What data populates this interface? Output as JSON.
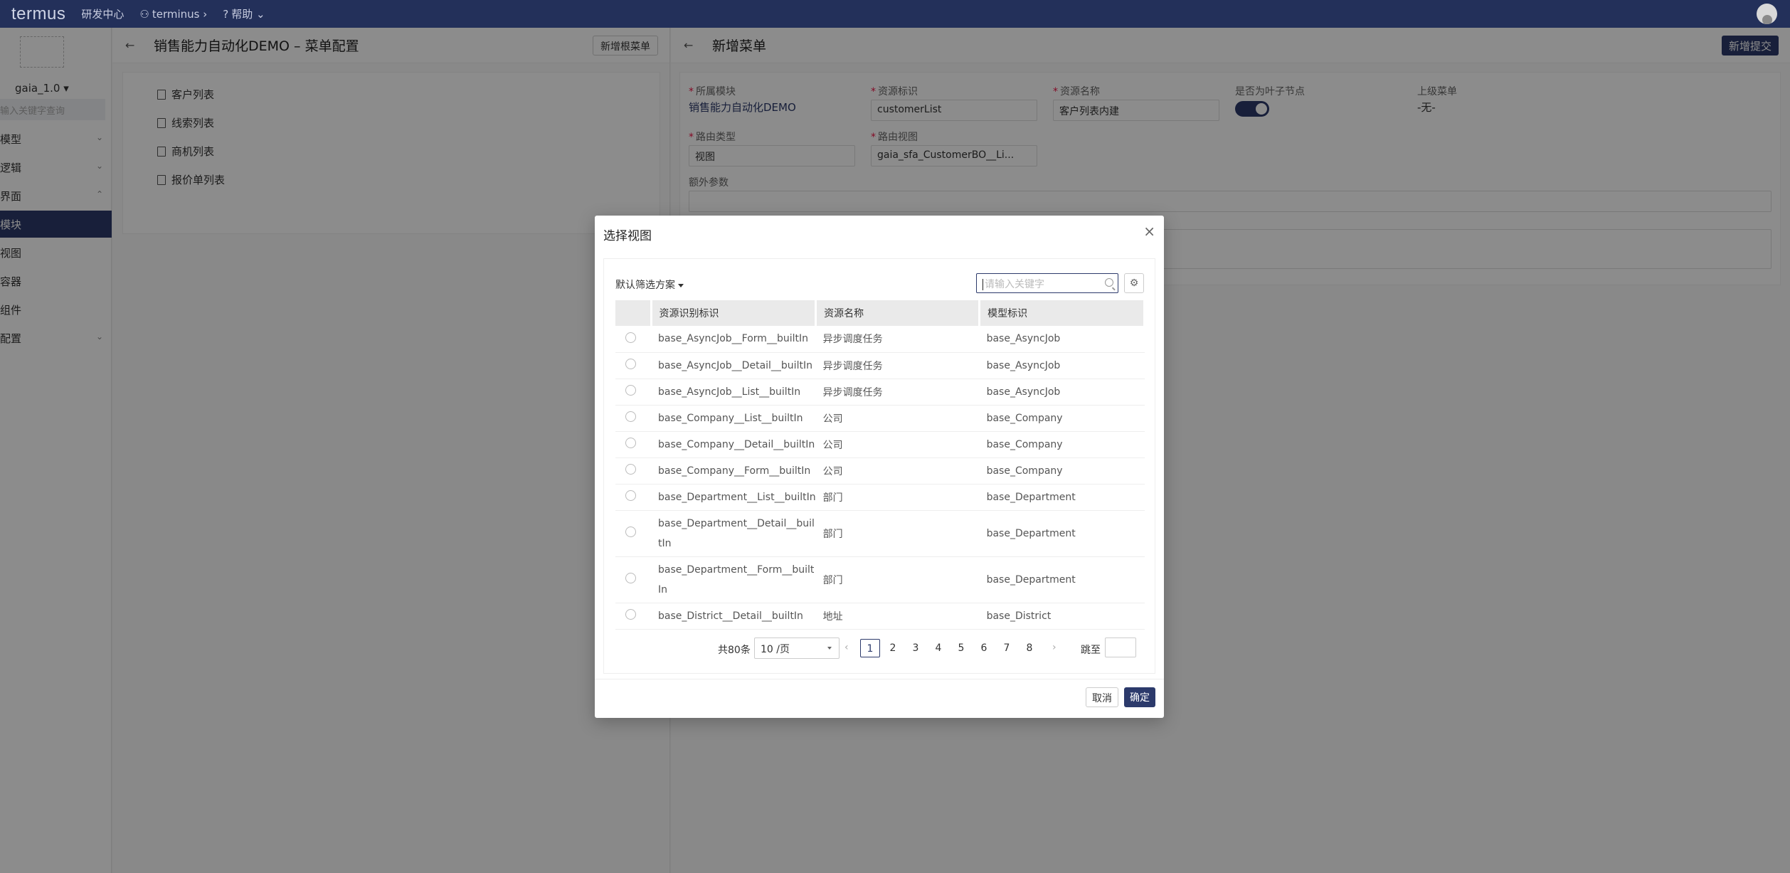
{
  "topbar": {
    "logo": "termus",
    "items": [
      {
        "label": "研发中心"
      },
      {
        "label": "terminus ›"
      },
      {
        "label": "帮助 ⌄"
      }
    ]
  },
  "sidebar": {
    "version": "gaia_1.0 ▾",
    "search_placeholder": "输入关键字查询",
    "items": [
      {
        "label": "模型",
        "caret": "⌄"
      },
      {
        "label": "逻辑",
        "caret": "⌄"
      },
      {
        "label": "界面",
        "caret": "⌃"
      },
      {
        "label": "模块",
        "caret": ""
      },
      {
        "label": "视图",
        "caret": ""
      },
      {
        "label": "容器",
        "caret": ""
      },
      {
        "label": "组件",
        "caret": ""
      },
      {
        "label": "配置",
        "caret": "⌄"
      }
    ]
  },
  "left_panel": {
    "back": "←",
    "title": "销售能力自动化DEMO – 菜单配置",
    "add_root_btn": "新增根菜单",
    "tree": [
      "客户列表",
      "线索列表",
      "商机列表",
      "报价单列表"
    ]
  },
  "right_panel": {
    "back": "←",
    "title": "新增菜单",
    "submit_btn": "新增提交",
    "fields": {
      "module_label": "所属模块",
      "module_value": "销售能力自动化DEMO",
      "resource_id_label": "资源标识",
      "resource_id_value": "customerList",
      "resource_name_label": "资源名称",
      "resource_name_value": "客户列表内建",
      "leaf_label": "是否为叶子节点",
      "parent_label": "上级菜单",
      "parent_value": "-无-",
      "route_type_label": "路由类型",
      "route_type_value": "视图",
      "route_view_label": "路由视图",
      "route_view_value": "gaia_sfa_CustomerBO__Li...",
      "extra_label": "额外参数"
    }
  },
  "modal": {
    "title": "选择视图",
    "close": "×",
    "filter_label": "默认筛选方案",
    "search_placeholder": "请输入关键字",
    "columns": [
      "资源识别标识",
      "资源名称",
      "模型标识"
    ],
    "rows": [
      {
        "id": "base_AsyncJob__Form__builtIn",
        "name": "异步调度任务",
        "model": "base_AsyncJob"
      },
      {
        "id": "base_AsyncJob__Detail__builtIn",
        "name": "异步调度任务",
        "model": "base_AsyncJob"
      },
      {
        "id": "base_AsyncJob__List__builtIn",
        "name": "异步调度任务",
        "model": "base_AsyncJob"
      },
      {
        "id": "base_Company__List__builtIn",
        "name": "公司",
        "model": "base_Company"
      },
      {
        "id": "base_Company__Detail__builtIn",
        "name": "公司",
        "model": "base_Company"
      },
      {
        "id": "base_Company__Form__builtIn",
        "name": "公司",
        "model": "base_Company"
      },
      {
        "id": "base_Department__List__builtIn",
        "name": "部门",
        "model": "base_Department"
      },
      {
        "id": "base_Department__Detail__builtIn",
        "name": "部门",
        "model": "base_Department"
      },
      {
        "id": "base_Department__Form__builtIn",
        "name": "部门",
        "model": "base_Department"
      },
      {
        "id": "base_District__Detail__builtIn",
        "name": "地址",
        "model": "base_District"
      }
    ],
    "pager": {
      "total": "共80条",
      "page_size": "10 /页",
      "prev": "‹",
      "next": "›",
      "pages": [
        "1",
        "2",
        "3",
        "4",
        "5",
        "6",
        "7",
        "8"
      ],
      "current": "1",
      "jump_label": "跳至"
    },
    "cancel": "取消",
    "ok": "确定"
  },
  "colors": {
    "topbar": "#23305a",
    "primary": "#2c3a6b"
  }
}
